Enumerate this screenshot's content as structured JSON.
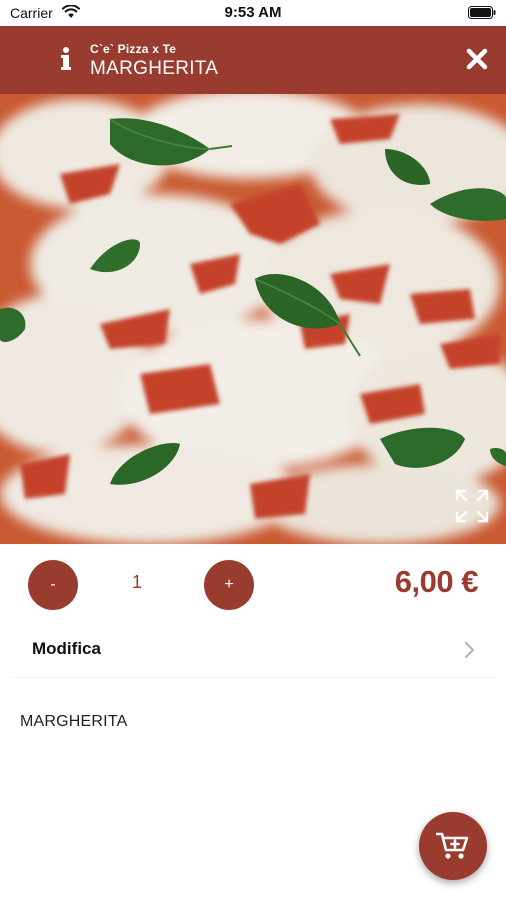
{
  "status_bar": {
    "carrier": "Carrier",
    "time": "9:53 AM"
  },
  "header": {
    "subtitle": "C`e` Pizza x Te",
    "title": "MARGHERITA",
    "background_color": "#9a3b2f",
    "icons": [
      "info-icon",
      "close-icon"
    ]
  },
  "product_image": {
    "subject": "margherita pizza photo",
    "expand_icon": "expand-icon"
  },
  "quantity": {
    "minus_label": "-",
    "value": "1",
    "plus_label": "+"
  },
  "price": "6,00 €",
  "modifica": {
    "label": "Modifica",
    "icon": "chevron-right-icon"
  },
  "description": "MARGHERITA",
  "cart_button": {
    "icon": "add-to-cart-icon"
  },
  "colors": {
    "accent": "#9a3b2f",
    "background": "#ffffff"
  }
}
